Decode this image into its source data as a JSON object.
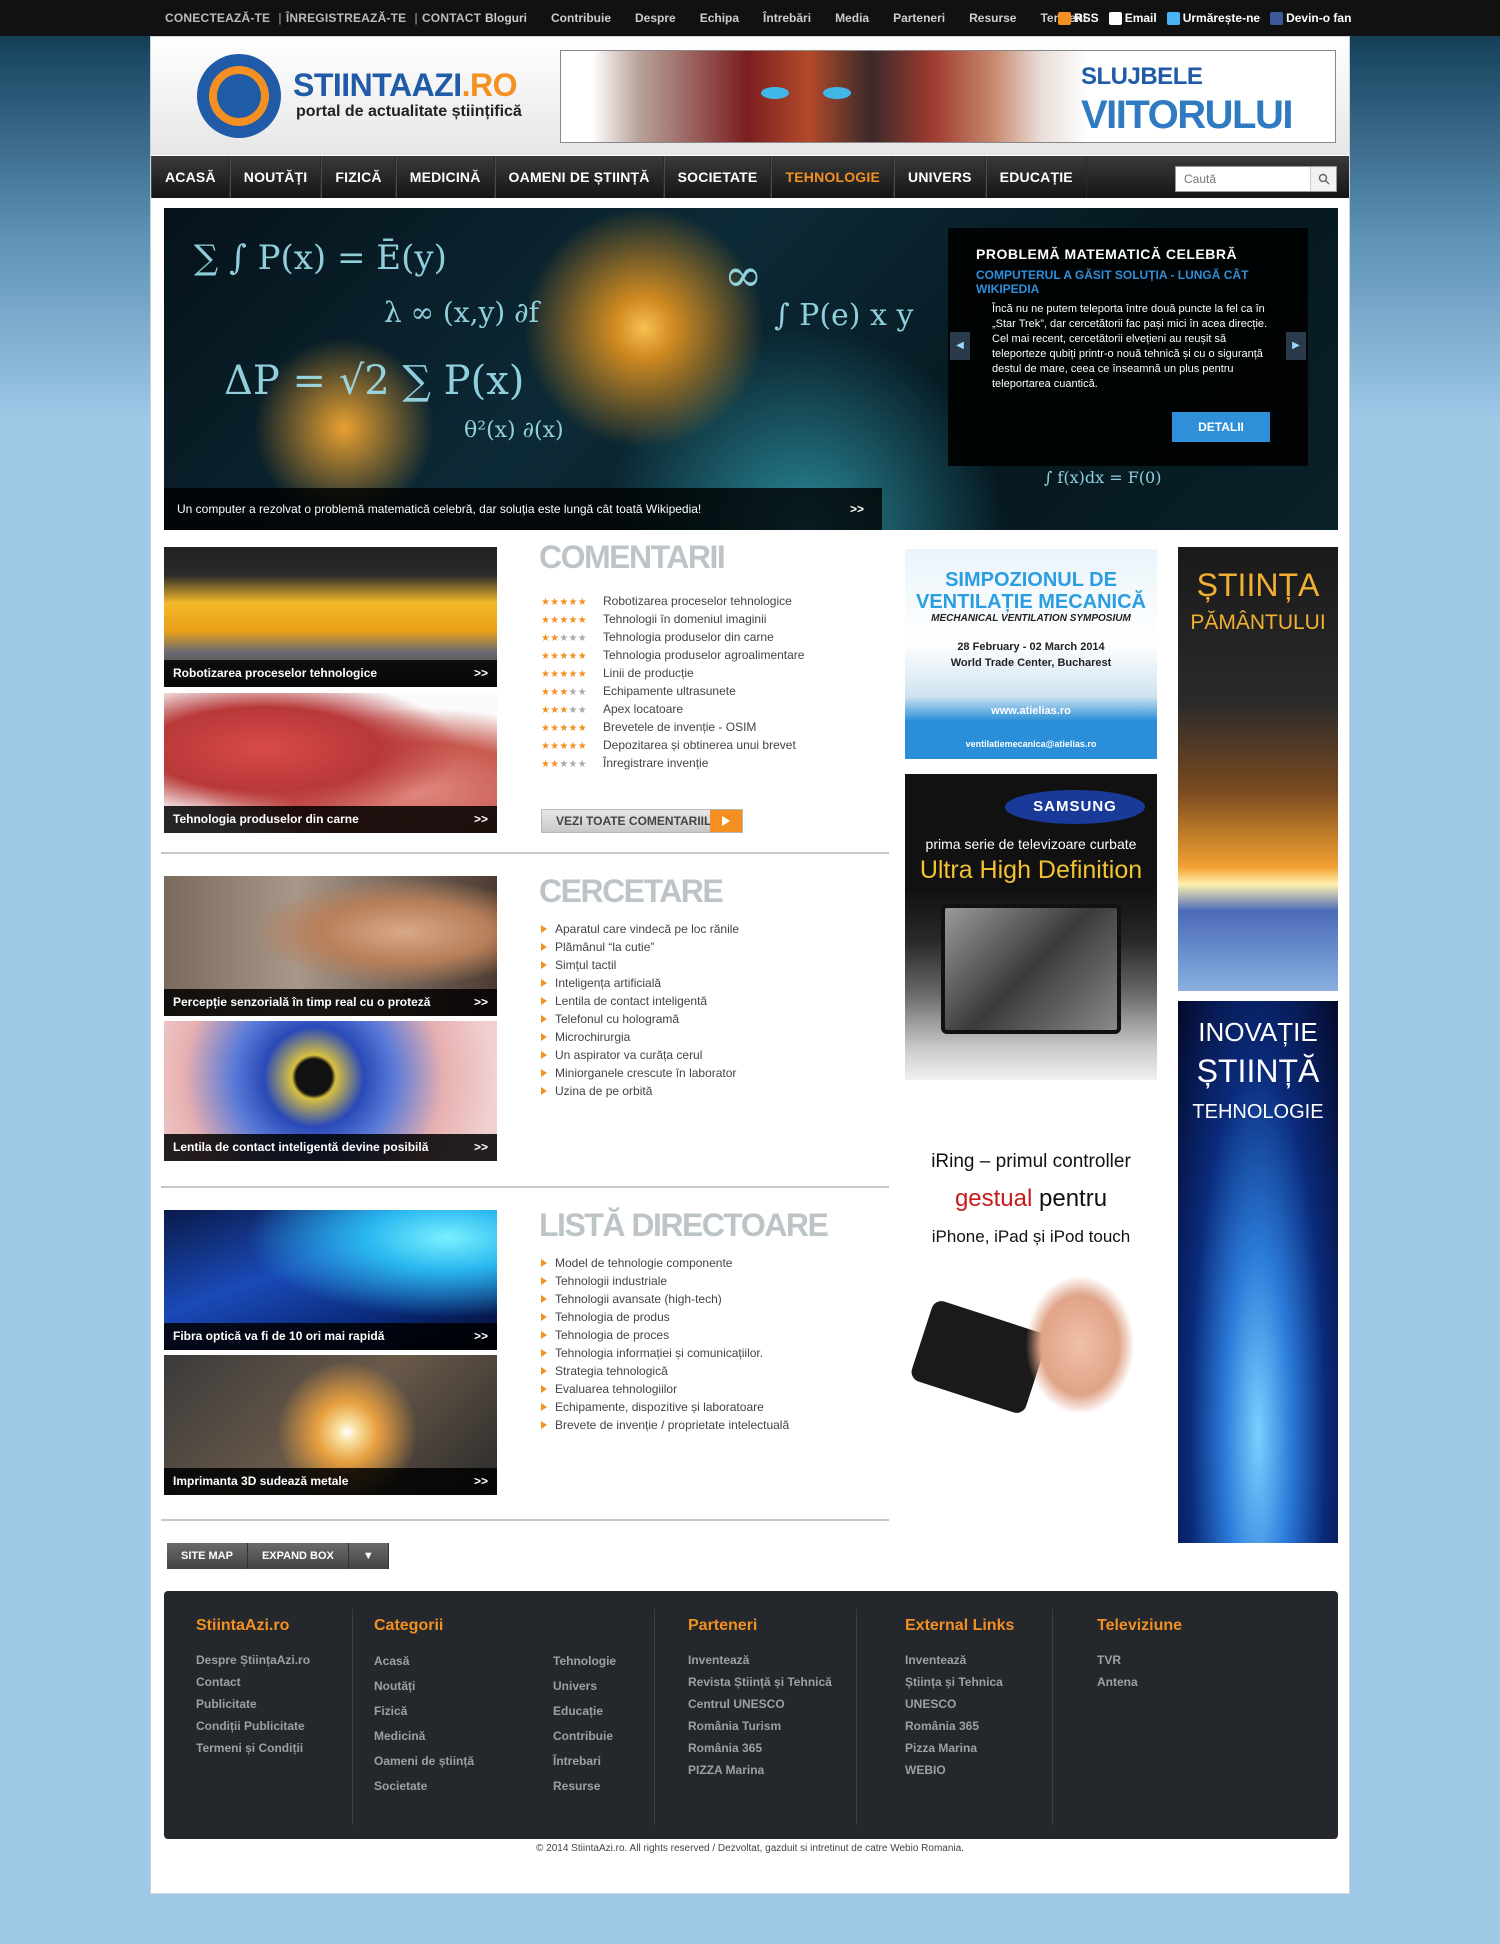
{
  "topbar": {
    "links": [
      "CONECTEAZĂ-TE",
      "ÎNREGISTREAZĂ-TE",
      "CONTACT"
    ],
    "nav": [
      "Bloguri",
      "Contribuie",
      "Despre",
      "Echipa",
      "Întrebări",
      "Media",
      "Parteneri",
      "Resurse",
      "Termeni"
    ],
    "social": [
      {
        "label": "RSS",
        "color": "#f39021",
        "icon": "rss-icon"
      },
      {
        "label": "Email",
        "color": "#ffffff",
        "icon": "email-icon"
      },
      {
        "label": "Urmărește-ne",
        "color": "#4ab3f4",
        "icon": "twitter-icon"
      },
      {
        "label": "Devin-o fan",
        "color": "#3b5998",
        "icon": "facebook-icon"
      }
    ]
  },
  "header": {
    "logo_name_a": "STIINTA",
    "logo_name_b": "AZI",
    "logo_name_c": ".RO",
    "tagline": "portal de actualitate științifică",
    "banner": {
      "line1": "SLUJBELE",
      "line2": "VIITORULUI"
    }
  },
  "mainnav": {
    "items": [
      "ACASĂ",
      "NOUTĂȚI",
      "FIZICĂ",
      "MEDICINĂ",
      "OAMENI DE ȘTIINȚĂ",
      "SOCIETATE",
      "TEHNOLOGIE",
      "UNIVERS",
      "EDUCAȚIE"
    ],
    "active": "TEHNOLOGIE",
    "search_placeholder": "Caută"
  },
  "slider": {
    "caption": "Un computer a rezolvat o problemă matematică celebră, dar soluția este lungă cât toată Wikipedia!",
    "caption_arrow": ">>",
    "box": {
      "title": "PROBLEMĂ MATEMATICĂ CELEBRĂ",
      "subtitle": "COMPUTERUL A GĂSIT SOLUȚIA - LUNGĂ CÂT WIKIPEDIA",
      "body": "Încă nu ne putem teleporta între două puncte la fel ca în „Star Trek”, dar cercetătorii fac pași mici în acea direcție. Cel mai recent, cercetătorii elvețieni au reușit să teleporteze qubiți printr-o nouă tehnică și cu o siguranță destul de mare, ceea ce înseamnă un plus pentru teleportarea cuantică.",
      "button": "DETALII"
    }
  },
  "comentarii": {
    "title": "COMENTARII",
    "tiles": [
      "Robotizarea proceselor tehnologice",
      "Tehnologia produselor din carne"
    ],
    "items": [
      {
        "label": "Robotizarea proceselor tehnologice",
        "rating": 5
      },
      {
        "label": "Tehnologii în domeniul imaginii",
        "rating": 5
      },
      {
        "label": "Tehnologia produselor din carne",
        "rating": 2
      },
      {
        "label": "Tehnologia produselor agroalimentare",
        "rating": 5
      },
      {
        "label": "Linii de producție",
        "rating": 5
      },
      {
        "label": "Echipamente ultrasunete",
        "rating": 3
      },
      {
        "label": "Apex locatoare",
        "rating": 3
      },
      {
        "label": "Brevetele de invenție - OSIM",
        "rating": 5
      },
      {
        "label": "Depozitarea și obtinerea unui brevet",
        "rating": 5
      },
      {
        "label": "Înregistrare invenție",
        "rating": 2
      }
    ],
    "button": "VEZI TOATE COMENTARIILE"
  },
  "cercetare": {
    "title": "CERCETARE",
    "tiles": [
      "Percepție senzorială în timp real cu o proteză",
      "Lentila de contact inteligentă devine posibilă"
    ],
    "items": [
      "Aparatul care vindecă pe loc rănile",
      "Plămânul “la cutie”",
      "Simțul tactil",
      "Inteligența artificială",
      "Lentila de contact inteligentă",
      "Telefonul cu hologramă",
      "Microchirurgia",
      "Un aspirator va curăța cerul",
      "Miniorganele crescute în laborator",
      "Uzina de pe orbită"
    ]
  },
  "directoare": {
    "title": "LISTĂ DIRECTOARE",
    "tiles": [
      "Fibra optică va fi de 10 ori mai rapidă",
      "Imprimanta 3D sudează metale"
    ],
    "items": [
      "Model de tehnologie componente",
      "Tehnologii industriale",
      "Tehnologii avansate (high-tech)",
      "Tehnologia de produs",
      "Tehnologia de proces",
      "Tehnologia informației și comunicațiilor.",
      "Strategia tehnologică",
      "Evaluarea tehnologiilor",
      "Echipamente, dispozitive și laboratoare",
      "Brevete de invenție / proprietate intelectuală"
    ]
  },
  "tile_arrow": ">>",
  "ads": {
    "simpozion": {
      "l1": "SIMPOZIONUL DE",
      "l2": "VENTILAȚIE MECANICĂ",
      "l3": "MECHANICAL VENTILATION SYMPOSIUM",
      "l4": "28 February - 02 March 2014",
      "l5": "World Trade Center, Bucharest",
      "l6": "www.atielias.ro",
      "l7": "ventilatiemecanica@atielias.ro"
    },
    "samsung": {
      "brand": "SAMSUNG",
      "l1": "prima serie de televizoare curbate",
      "l2": "Ultra High Definition"
    },
    "iring": {
      "l1": "iRing – primul controller",
      "l2a": "gestual",
      "l2b": " pentru",
      "l3": "iPhone, iPad și iPod touch"
    },
    "stiinta": {
      "l1": "ȘTIINȚA",
      "l2": "PĂMÂNTULUI"
    },
    "inovatie": {
      "l1": "INOVAȚIE",
      "l2": "ȘTIINȚĂ",
      "l3": "TEHNOLOGIE"
    }
  },
  "sitemap": {
    "b1": "SITE MAP",
    "b2": "EXPAND BOX",
    "b3": "▼"
  },
  "footer": {
    "cols": [
      {
        "title": "StiintaAzi.ro",
        "items": [
          "Despre ȘtiințaAzi.ro",
          "Contact",
          "Publicitate",
          "Condiții Publicitate",
          "Termeni și Condiții"
        ]
      },
      {
        "title": "Categorii",
        "items": [
          "Acasă",
          "Noutăți",
          "Fizică",
          "Medicină",
          "Oameni de știință",
          "Societate"
        ],
        "items2": [
          "Tehnologie",
          "Univers",
          "Educație",
          "Contribuie",
          "Întrebari",
          "Resurse"
        ]
      },
      {
        "title": "Parteneri",
        "items": [
          "Inventează",
          "Revista Știință și Tehnică",
          "Centrul UNESCO",
          "România Turism",
          "România 365",
          "PIZZA Marina"
        ]
      },
      {
        "title": "External Links",
        "items": [
          "Inventează",
          "Știința și Tehnica",
          "UNESCO",
          "România 365",
          "Pizza Marina",
          "WEBIO"
        ]
      },
      {
        "title": "Televiziune",
        "items": [
          "TVR",
          "Antena"
        ]
      }
    ]
  },
  "copyright": "© 2014 StiintaAzi.ro. All rights reserved / Dezvoltat, gazduit si intretinut de catre Webio Romania."
}
